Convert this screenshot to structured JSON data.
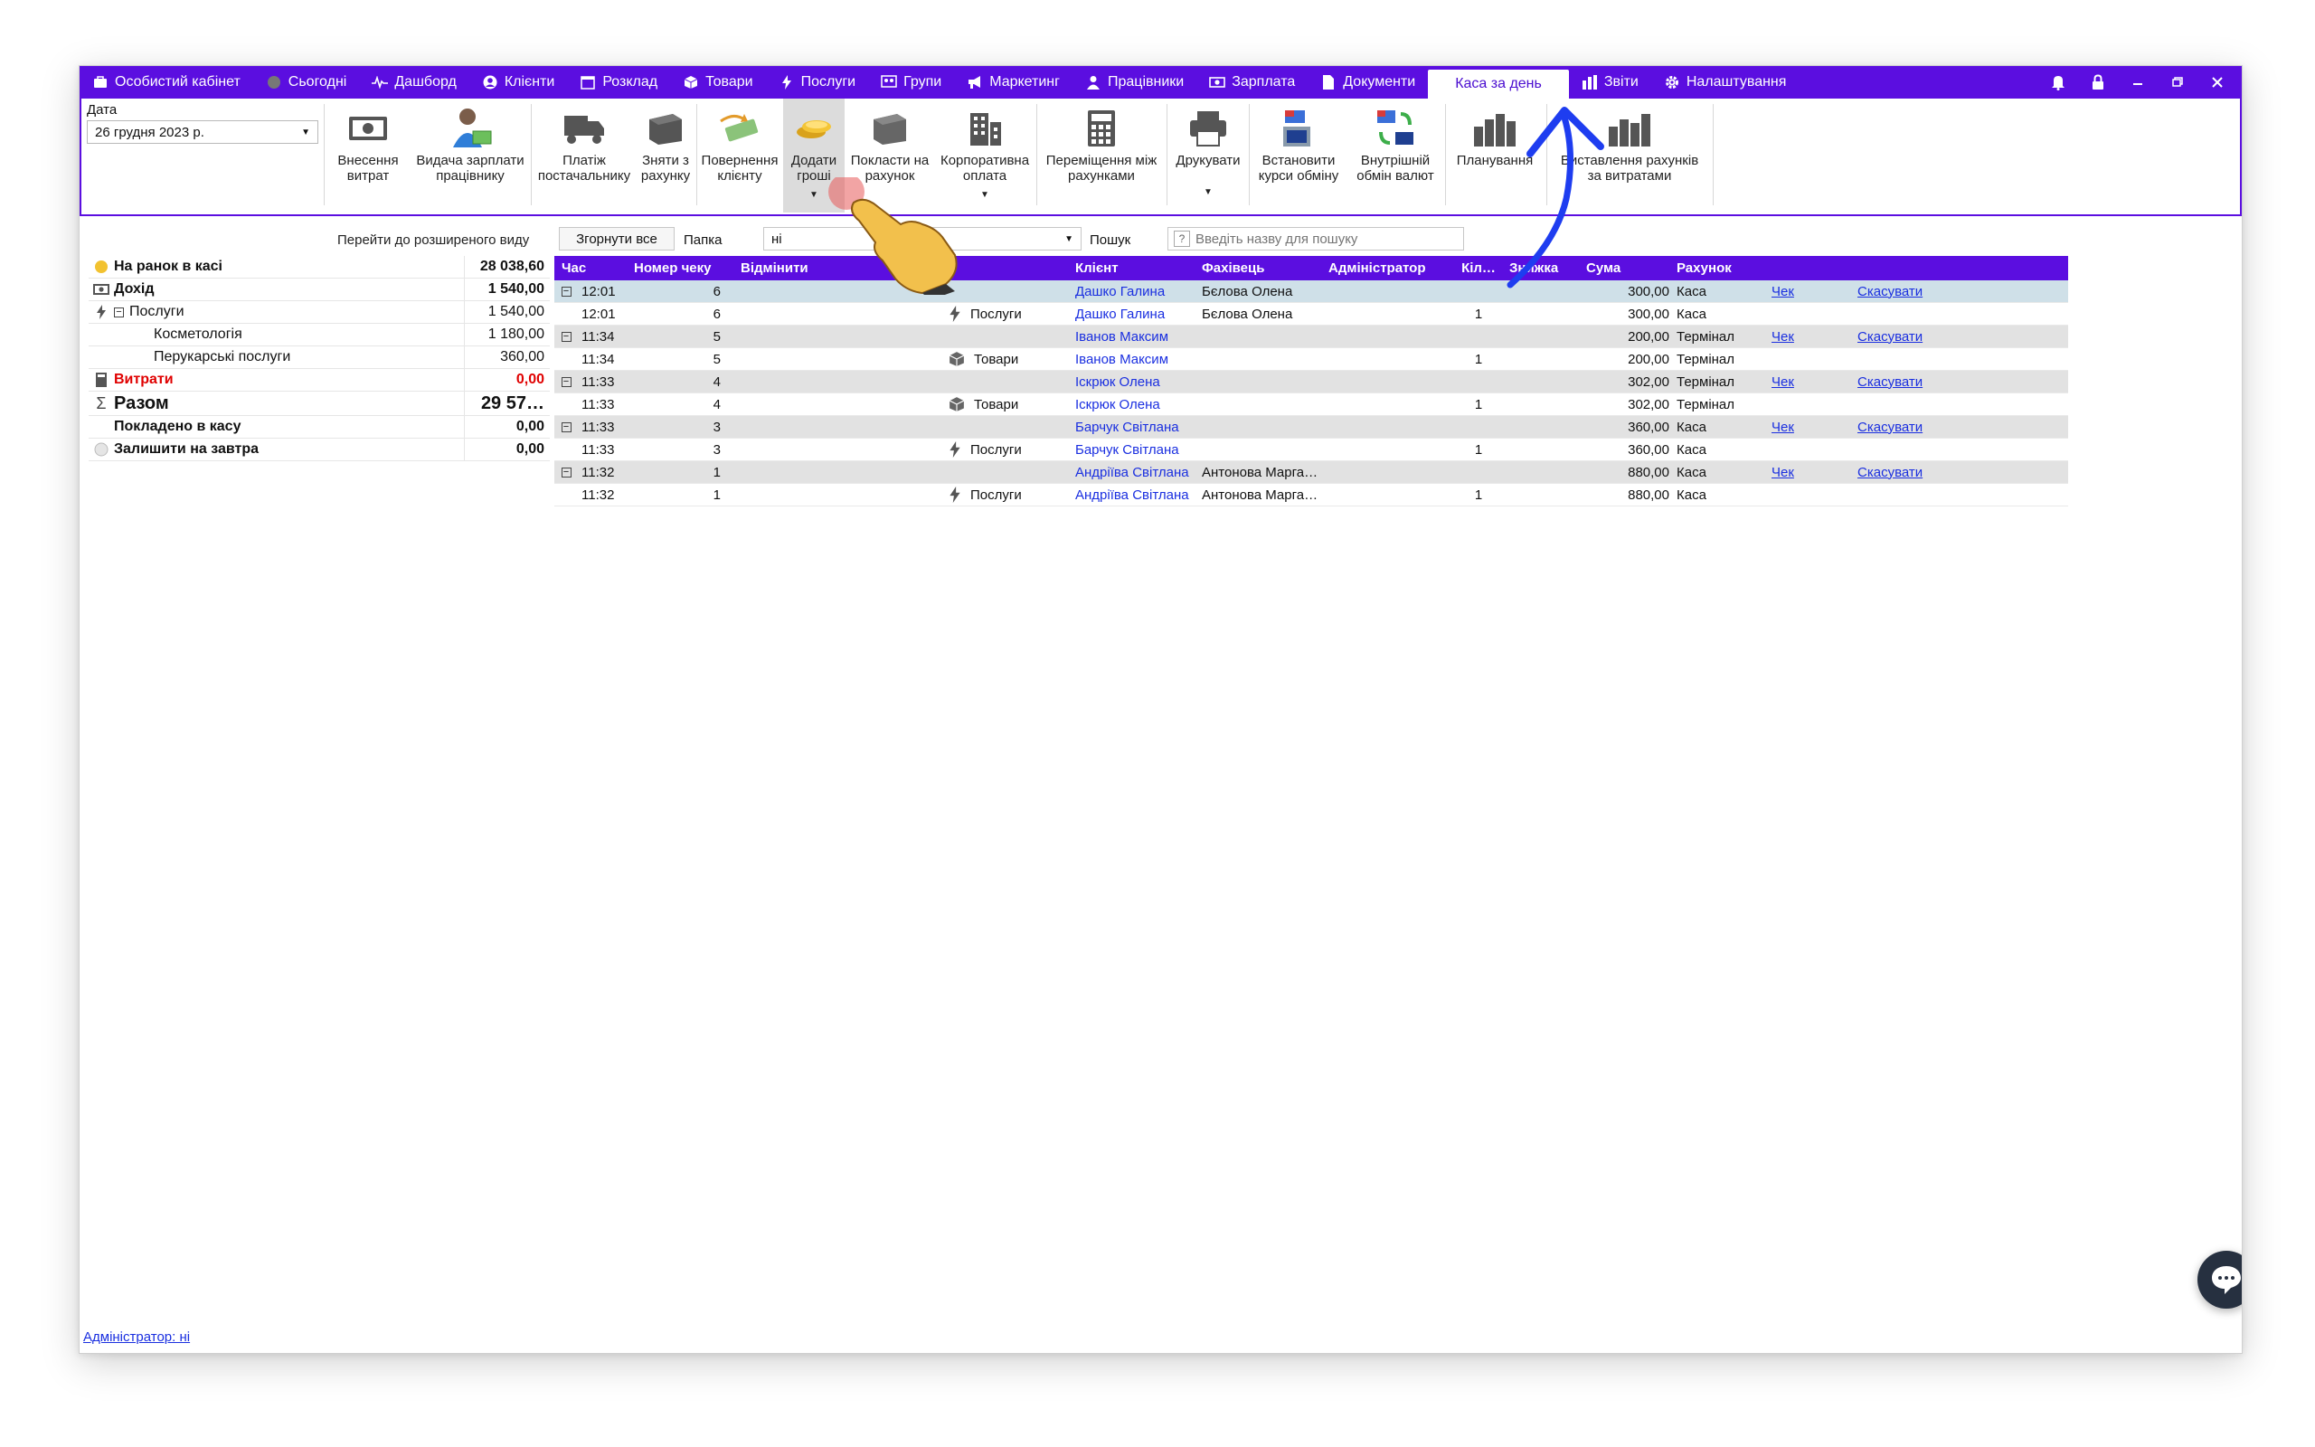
{
  "menu": {
    "items": [
      {
        "label": "Особистий кабінет",
        "icon": "cabinet-icon"
      },
      {
        "label": "Сьогодні",
        "icon": "today-icon"
      },
      {
        "label": "Дашборд",
        "icon": "pulse-icon"
      },
      {
        "label": "Клієнти",
        "icon": "user-circle-icon"
      },
      {
        "label": "Розклад",
        "icon": "calendar-icon"
      },
      {
        "label": "Товари",
        "icon": "box-icon"
      },
      {
        "label": "Послуги",
        "icon": "lightning-icon"
      },
      {
        "label": "Групи",
        "icon": "group-icon"
      },
      {
        "label": "Маркетинг",
        "icon": "megaphone-icon"
      },
      {
        "label": "Працівники",
        "icon": "person-icon"
      },
      {
        "label": "Зарплата",
        "icon": "cash-icon"
      },
      {
        "label": "Документи",
        "icon": "document-icon"
      },
      {
        "label": "Каса за день",
        "icon": ""
      },
      {
        "label": "Звіти",
        "icon": "bar-chart-icon"
      },
      {
        "label": "Налаштування",
        "icon": "gear-icon"
      }
    ],
    "active": "Каса за день"
  },
  "ribbon": {
    "date_label": "Дата",
    "date_value": "26  грудня  2023 р.",
    "buttons": [
      {
        "l1": "Внесення",
        "l2": "витрат"
      },
      {
        "l1": "Видача зарплати",
        "l2": "працівнику"
      },
      {
        "l1": "Платіж",
        "l2": "постачальнику"
      },
      {
        "l1": "Зняти з",
        "l2": "рахунку"
      },
      {
        "l1": "Повернення",
        "l2": "клієнту"
      },
      {
        "l1": "Додати",
        "l2": "гроші"
      },
      {
        "l1": "Покласти на",
        "l2": "рахунок"
      },
      {
        "l1": "Корпоративна",
        "l2": "оплата"
      },
      {
        "l1": "Переміщення між",
        "l2": "рахунками"
      },
      {
        "l1": "Друкувати",
        "l2": ""
      },
      {
        "l1": "Встановити",
        "l2": "курси обміну"
      },
      {
        "l1": "Внутрішній",
        "l2": "обмін валют"
      },
      {
        "l1": "Планування",
        "l2": ""
      },
      {
        "l1": "Виставлення рахунків",
        "l2": "за витратами"
      }
    ]
  },
  "summary": {
    "link": "Перейти до розширеного виду",
    "rows": [
      {
        "label": "На ранок в касі",
        "value": "28 038,60"
      },
      {
        "label": "Дохід",
        "value": "1 540,00"
      },
      {
        "label": "Послуги",
        "value": "1 540,00"
      },
      {
        "label": "Косметологія",
        "value": "1 180,00"
      },
      {
        "label": "Перукарські послуги",
        "value": "360,00"
      },
      {
        "label": "Витрати",
        "value": "0,00"
      },
      {
        "label": "Разом",
        "value": "29 57…"
      },
      {
        "label": "Покладено в касу",
        "value": "0,00"
      },
      {
        "label": "Залишити на завтра",
        "value": "0,00"
      }
    ]
  },
  "toolbar": {
    "collapse_label": "Згорнути все",
    "folder_label": "Папка",
    "folder_value": "ні",
    "search_label": "Пошук",
    "search_placeholder": "Введіть назву для пошуку",
    "help": "?"
  },
  "grid": {
    "headers": [
      "Час",
      "Номер чеку",
      "Відмінити",
      "",
      "Клієнт",
      "Фахівець",
      "Адміністратор",
      "Кіл…",
      "Знижка",
      "Сума",
      "Рахунок",
      "",
      ""
    ],
    "rows": [
      {
        "group": true,
        "selected": true,
        "time": "12:01",
        "num": "6",
        "svc": "",
        "client": "Дашко Галина",
        "spec": "Бєлова Олена",
        "admin": "",
        "qty": "",
        "sum": "300,00",
        "acc": "Каса",
        "check": "Чек",
        "cancel": "Скасувати"
      },
      {
        "group": false,
        "time": "12:01",
        "num": "6",
        "svc": "Послуги",
        "svc_icon": "lightning-icon",
        "client": "Дашко Галина",
        "spec": "Бєлова Олена",
        "admin": "",
        "qty": "1",
        "sum": "300,00",
        "acc": "Каса",
        "check": "",
        "cancel": ""
      },
      {
        "group": true,
        "time": "11:34",
        "num": "5",
        "svc": "",
        "client": "Іванов Максим",
        "spec": "",
        "admin": "",
        "qty": "",
        "sum": "200,00",
        "acc": "Термінал",
        "check": "Чек",
        "cancel": "Скасувати"
      },
      {
        "group": false,
        "time": "11:34",
        "num": "5",
        "svc": "Товари",
        "svc_icon": "box-icon",
        "client": "Іванов Максим",
        "spec": "",
        "admin": "",
        "qty": "1",
        "sum": "200,00",
        "acc": "Термінал",
        "check": "",
        "cancel": ""
      },
      {
        "group": true,
        "time": "11:33",
        "num": "4",
        "svc": "",
        "client": "Іскрюк Олена",
        "spec": "",
        "admin": "",
        "qty": "",
        "sum": "302,00",
        "acc": "Термінал",
        "check": "Чек",
        "cancel": "Скасувати"
      },
      {
        "group": false,
        "time": "11:33",
        "num": "4",
        "svc": "Товари",
        "svc_icon": "box-icon",
        "client": "Іскрюк Олена",
        "spec": "",
        "admin": "",
        "qty": "1",
        "sum": "302,00",
        "acc": "Термінал",
        "check": "",
        "cancel": ""
      },
      {
        "group": true,
        "time": "11:33",
        "num": "3",
        "svc": "",
        "client": "Барчук Світлана",
        "spec": "",
        "admin": "",
        "qty": "",
        "sum": "360,00",
        "acc": "Каса",
        "check": "Чек",
        "cancel": "Скасувати"
      },
      {
        "group": false,
        "time": "11:33",
        "num": "3",
        "svc": "Послуги",
        "svc_icon": "lightning-icon",
        "client": "Барчук Світлана",
        "spec": "",
        "admin": "",
        "qty": "1",
        "sum": "360,00",
        "acc": "Каса",
        "check": "",
        "cancel": ""
      },
      {
        "group": true,
        "time": "11:32",
        "num": "1",
        "svc": "",
        "client": "Андріїва Світлана",
        "spec": "Антонова Марга…",
        "admin": "",
        "qty": "",
        "sum": "880,00",
        "acc": "Каса",
        "check": "Чек",
        "cancel": "Скасувати"
      },
      {
        "group": false,
        "time": "11:32",
        "num": "1",
        "svc": "Послуги",
        "svc_icon": "lightning-icon",
        "client": "Андріїва Світлана",
        "spec": "Антонова Марга…",
        "admin": "",
        "qty": "1",
        "sum": "880,00",
        "acc": "Каса",
        "check": "",
        "cancel": ""
      }
    ]
  },
  "footer": {
    "admin_link": "Адміністратор: ні"
  },
  "colors": {
    "accent": "#5b0ee0",
    "link": "#1a2fe0",
    "expense": "#e00000",
    "annotation_arrow": "#1e3df0"
  }
}
